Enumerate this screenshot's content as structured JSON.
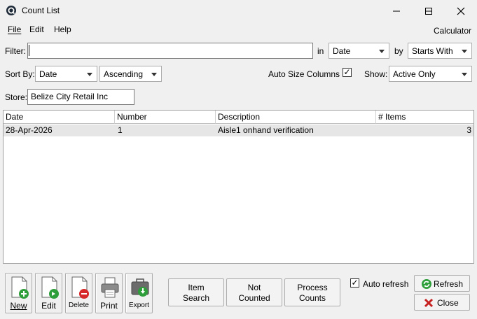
{
  "window": {
    "title": "Count List"
  },
  "menu": {
    "file": "File",
    "edit": "Edit",
    "help": "Help",
    "calculator": "Calculator"
  },
  "filter": {
    "label": "Filter:",
    "value": "",
    "in_label": "in",
    "in_value": "Date",
    "by_label": "by",
    "by_value": "Starts With"
  },
  "sort": {
    "label": "Sort By:",
    "field": "Date",
    "order": "Ascending",
    "auto_size_label": "Auto Size Columns",
    "auto_size_checked": "✓",
    "show_label": "Show:",
    "show_value": "Active Only"
  },
  "store": {
    "label": "Store:",
    "value": "Belize City Retail Inc"
  },
  "grid": {
    "columns": [
      "Date",
      "Number",
      "Description",
      "# Items"
    ],
    "rows": [
      {
        "date": "28-Apr-2026",
        "number": "1",
        "description": "Aisle1 onhand verification",
        "items": "3"
      }
    ]
  },
  "toolbar": {
    "new": "New",
    "edit": "Edit",
    "delete": "Delete",
    "print": "Print",
    "export": "Export",
    "item_search_1": "Item",
    "item_search_2": "Search",
    "not_counted_1": "Not",
    "not_counted_2": "Counted",
    "process_counts_1": "Process",
    "process_counts_2": "Counts",
    "auto_refresh_label": "Auto refresh",
    "auto_refresh_checked": "✓",
    "refresh": "Refresh",
    "close": "Close"
  },
  "colors": {
    "accent_green": "#2e9e3a",
    "delete_red": "#d62828",
    "close_red": "#c62020"
  }
}
